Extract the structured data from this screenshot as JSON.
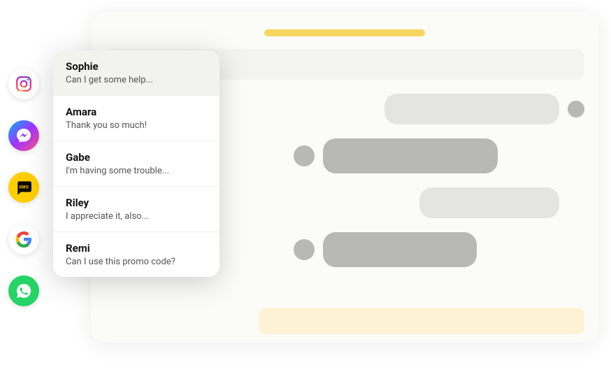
{
  "conversations": [
    {
      "name": "Sophie",
      "preview": "Can I get some help...",
      "active": true
    },
    {
      "name": "Amara",
      "preview": "Thank you so much!",
      "active": false
    },
    {
      "name": "Gabe",
      "preview": "I'm having some trouble...",
      "active": false
    },
    {
      "name": "Riley",
      "preview": "I appreciate it, also...",
      "active": false
    },
    {
      "name": "Remi",
      "preview": "Can I use this promo code?",
      "active": false
    }
  ],
  "channels": [
    {
      "id": "instagram",
      "label": "Instagram"
    },
    {
      "id": "messenger",
      "label": "Messenger"
    },
    {
      "id": "sms",
      "label": "SMS"
    },
    {
      "id": "google",
      "label": "Google"
    },
    {
      "id": "whatsapp",
      "label": "WhatsApp"
    }
  ]
}
